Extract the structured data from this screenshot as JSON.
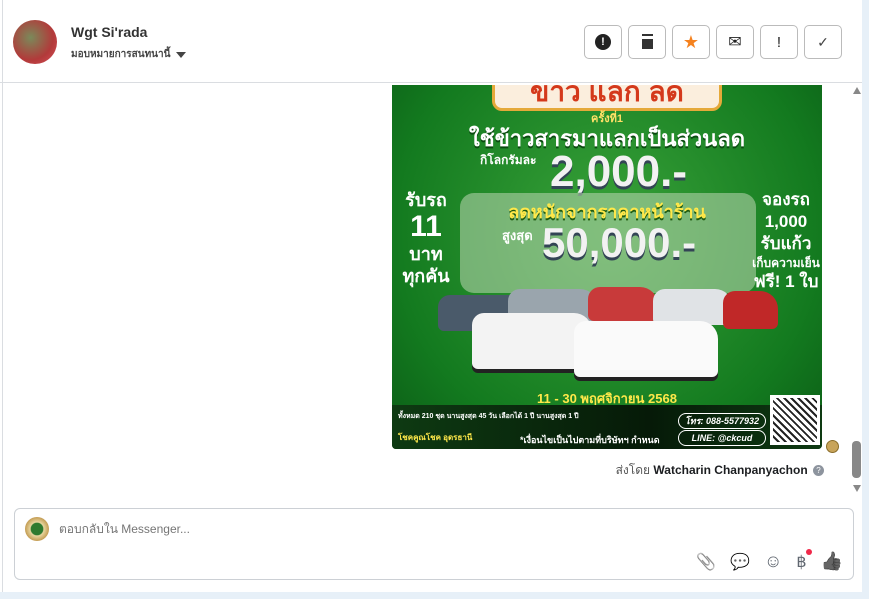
{
  "header": {
    "contact_name": "Wgt Si'rada",
    "assign_label": "มอบหมายการสนทนานี้",
    "actions": [
      {
        "name": "spam",
        "glyph": "❗"
      },
      {
        "name": "delete",
        "glyph": "🗑"
      },
      {
        "name": "star",
        "glyph": "★"
      },
      {
        "name": "mark-unread",
        "glyph": "✉"
      },
      {
        "name": "follow-up",
        "glyph": "!"
      },
      {
        "name": "done",
        "glyph": "✓"
      }
    ]
  },
  "poster": {
    "title": "ข้าว แลก ลด",
    "round": "ครั้งที่1",
    "line1": "ใช้ข้าวสารมาแลกเป็นส่วนลด",
    "per_kg": "กิโลกรัมละ",
    "amount1": "2,000.-",
    "line2": "ลดหนักจากราคาหน้าร้าน",
    "max_label": "สูงสุด",
    "amount2": "50,000.-",
    "left": [
      "รับรถ",
      "11",
      "บาท",
      "ทุกคัน"
    ],
    "right": [
      "จองรถ",
      "1,000",
      "รับแก้ว",
      "เก็บความเย็น",
      "ฟรี! 1 ใบ"
    ],
    "date": "11 - 30 พฤศจิกายน 2568",
    "stats": "ทั้งหมด 210 ชุด  นานสูงสุด 45 วัน  เลือกได้ 1 ปี  นานสูงสุด 1 ปี",
    "brand": "โชคคูณโชค อุดรธานี",
    "condition": "*เงื่อนไขเป็นไปตามที่บริษัทฯ กำหนด",
    "phone": "โทร: 088-5577932",
    "line_id": "LINE: @ckcud"
  },
  "message": {
    "sent_by_prefix": "ส่งโดย",
    "sent_by_name": "Watcharin Chanpanyachon",
    "help_glyph": "?"
  },
  "composer": {
    "placeholder": "ตอบกลับใน Messenger...",
    "icons": [
      "📎",
      "💬",
      "☺",
      "฿",
      "👍"
    ]
  },
  "colors": {
    "star": "#f5821f",
    "like": "#2b3a4a",
    "notification_dot": "#f02849"
  }
}
